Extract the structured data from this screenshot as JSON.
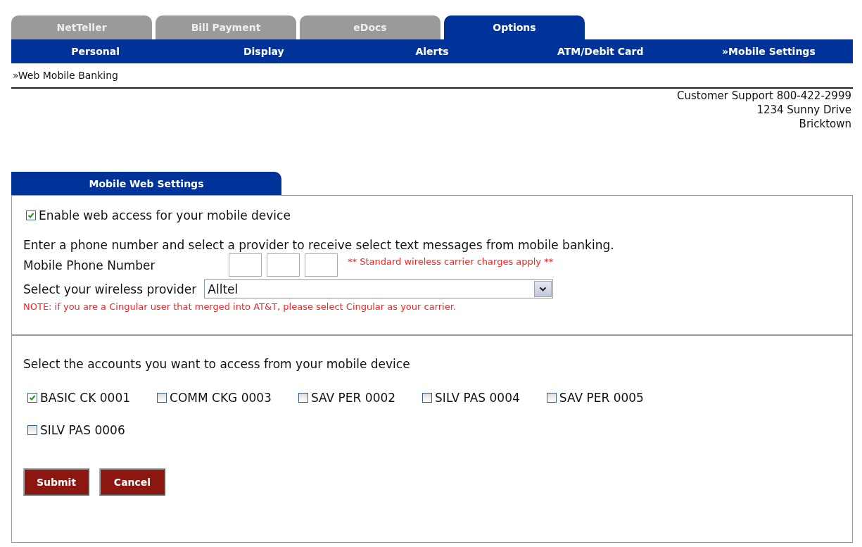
{
  "tabs": [
    {
      "label": "NetTeller",
      "selected": false
    },
    {
      "label": "Bill Payment",
      "selected": false
    },
    {
      "label": "eDocs",
      "selected": false
    },
    {
      "label": "Options",
      "selected": true
    }
  ],
  "subnav": [
    "Personal",
    "Display",
    "Alerts",
    "ATM/Debit Card",
    "»Mobile Settings"
  ],
  "breadcrumb": "»Web Mobile Banking",
  "contact": [
    "Customer Support 800-422-2999",
    "1234 Sunny Drive",
    "Bricktown"
  ],
  "panel": {
    "tab": "Mobile Web Settings",
    "enable": {
      "label": "Enable web access for your mobile device",
      "checked": true
    },
    "intro": "Enter a phone number and select a provider to receive select text messages from mobile banking.",
    "phone_label": "Mobile Phone Number",
    "phone_note": "** Standard wireless carrier charges apply **",
    "provider_label": "Select your wireless provider",
    "provider_value": "Alltel",
    "provider_note": "NOTE: if you are a Cingular user that merged into AT&T, please select Cingular as your carrier.",
    "accounts_label": "Select the accounts you want to access from your mobile device",
    "accounts": [
      {
        "label": "BASIC CK 0001",
        "checked": true
      },
      {
        "label": "COMM CKG 0003",
        "checked": false
      },
      {
        "label": "SAV PER 0002",
        "checked": false
      },
      {
        "label": "SILV PAS 0004",
        "checked": false
      },
      {
        "label": "SAV PER 0005",
        "checked": false
      },
      {
        "label": "SILV PAS 0006",
        "checked": false
      }
    ],
    "buttons": [
      "Submit",
      "Cancel"
    ]
  }
}
